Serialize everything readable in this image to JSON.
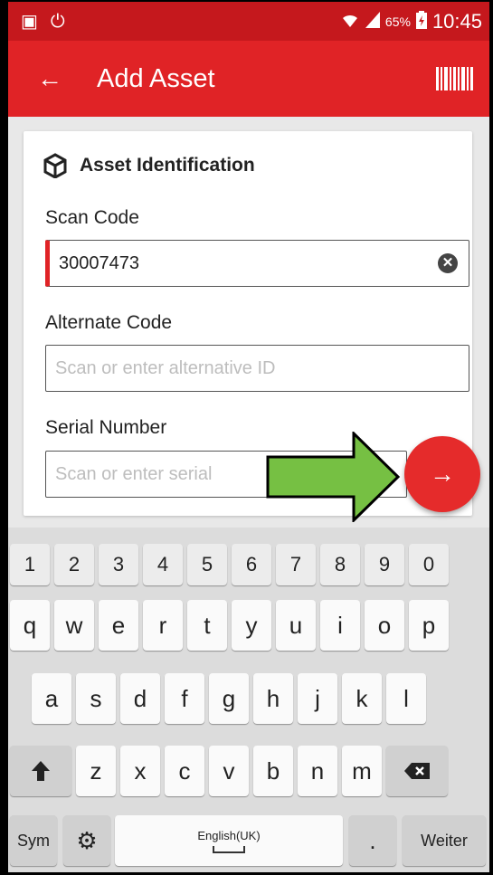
{
  "status_bar": {
    "left_icons": [
      "screenshot-icon",
      "sync-icon"
    ],
    "right_icons": [
      "wifi-icon",
      "signal-icon",
      "battery-icon"
    ],
    "battery": "65%",
    "time": "10:45"
  },
  "app_bar": {
    "title": "Add Asset",
    "back_icon": "arrow-left-icon",
    "action_icon": "barcode-icon"
  },
  "form": {
    "section_title": "Asset Identification",
    "section_icon": "cube-icon",
    "scan_code": {
      "label": "Scan Code",
      "value": "30007473"
    },
    "alternate_code": {
      "label": "Alternate Code",
      "placeholder": "Scan or enter alternative ID"
    },
    "serial_number": {
      "label": "Serial Number",
      "placeholder": "Scan or enter serial"
    },
    "next_icon": "arrow-right-icon"
  },
  "keyboard": {
    "numbers": [
      "1",
      "2",
      "3",
      "4",
      "5",
      "6",
      "7",
      "8",
      "9",
      "0"
    ],
    "row1": [
      "q",
      "w",
      "e",
      "r",
      "t",
      "y",
      "u",
      "i",
      "o",
      "p"
    ],
    "row2": [
      "a",
      "s",
      "d",
      "f",
      "g",
      "h",
      "j",
      "k",
      "l"
    ],
    "row3": [
      "z",
      "x",
      "c",
      "v",
      "b",
      "n",
      "m"
    ],
    "sym": "Sym",
    "space_label": "English(UK)",
    "punct": ".",
    "action": "Weiter"
  },
  "colors": {
    "brand": "#e02326",
    "status_bar": "#c5181d",
    "annotation_arrow": "#76c043"
  }
}
